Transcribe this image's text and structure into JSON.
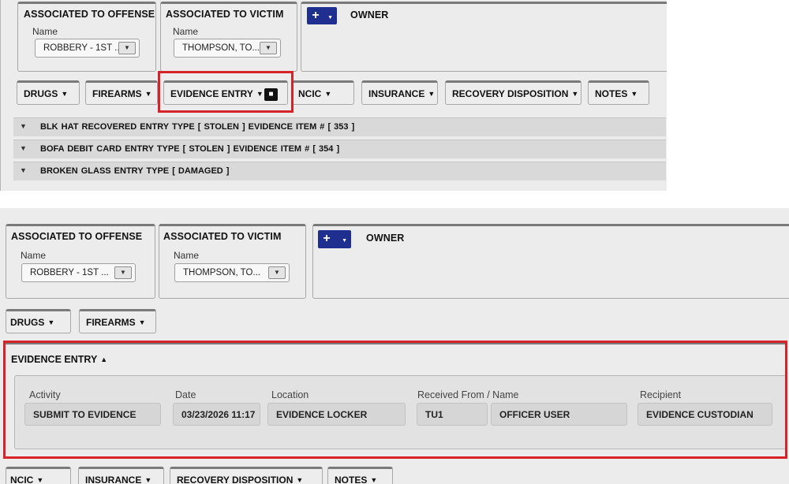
{
  "top_panel": {
    "offense": {
      "title": "ASSOCIATED TO OFFENSE",
      "name_label": "Name",
      "selected": "ROBBERY - 1ST ..."
    },
    "victim": {
      "title": "ASSOCIATED TO VICTIM",
      "name_label": "Name",
      "selected": "THOMPSON, TO..."
    },
    "owner": {
      "add_icon": "plus-icon",
      "title": "OWNER"
    },
    "tabs": [
      {
        "label": "DRUGS"
      },
      {
        "label": "FIREARMS"
      },
      {
        "label": "EVIDENCE ENTRY"
      },
      {
        "label": "NCIC"
      },
      {
        "label": "INSURANCE"
      },
      {
        "label": "RECOVERY DISPOSITION"
      },
      {
        "label": "NOTES"
      }
    ],
    "evidence_items": [
      "BLK HAT RECOVERED   ENTRY TYPE [ STOLEN ]   EVIDENCE ITEM # [ 353 ]",
      "BOFA DEBIT CARD   ENTRY TYPE [ STOLEN ]   EVIDENCE ITEM # [ 354 ]",
      "BROKEN GLASS   ENTRY TYPE [ DAMAGED ]"
    ]
  },
  "bottom_panel": {
    "offense": {
      "title": "ASSOCIATED TO OFFENSE",
      "name_label": "Name",
      "selected": "ROBBERY - 1ST ..."
    },
    "victim": {
      "title": "ASSOCIATED TO VICTIM",
      "name_label": "Name",
      "selected": "THOMPSON, TO..."
    },
    "owner": {
      "title": "OWNER"
    },
    "tabs_before": [
      {
        "label": "DRUGS"
      },
      {
        "label": "FIREARMS"
      }
    ],
    "evidence_entry": {
      "title": "EVIDENCE ENTRY",
      "columns": {
        "activity": "Activity",
        "date": "Date",
        "location": "Location",
        "received_from": "Received From / Name",
        "recipient": "Recipient"
      },
      "values": {
        "activity": "SUBMIT TO EVIDENCE",
        "date": "03/23/2026 11:17",
        "location": "EVIDENCE LOCKER",
        "received_from_id": "TU1",
        "received_from_name": "OFFICER USER",
        "recipient": "EVIDENCE CUSTODIAN"
      }
    },
    "tabs_after": [
      {
        "label": "NCIC"
      },
      {
        "label": "INSURANCE"
      },
      {
        "label": "RECOVERY DISPOSITION"
      },
      {
        "label": "NOTES"
      }
    ]
  },
  "colors": {
    "highlight": "#d6232a",
    "add_button": "#1f2f8f",
    "panel_bg": "#ececec"
  }
}
